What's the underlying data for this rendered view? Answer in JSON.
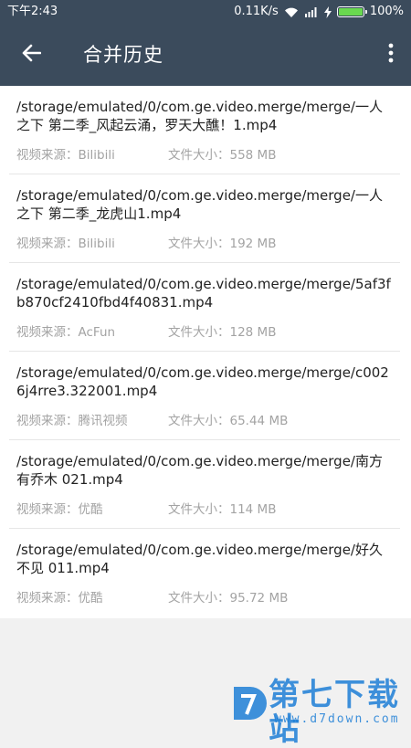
{
  "status_bar": {
    "time": "下午2:43",
    "speed": "0.11K/s",
    "battery": "100%",
    "battery_level": 1.0,
    "battery_color": "#69d84f"
  },
  "toolbar": {
    "title": "合并历史",
    "back_icon": "back-arrow-icon",
    "menu_icon": "more-vertical-icon",
    "background": "#3b4b5c"
  },
  "items": [
    {
      "path": "/storage/emulated/0/com.ge.video.merge/merge/一人之下 第二季_风起云涌，罗天大醮！1.mp4",
      "source": "视频来源：Bilibili",
      "size": "文件大小：558 MB"
    },
    {
      "path": "/storage/emulated/0/com.ge.video.merge/merge/一人之下 第二季_龙虎山1.mp4",
      "source": "视频来源：Bilibili",
      "size": "文件大小：192 MB"
    },
    {
      "path": "/storage/emulated/0/com.ge.video.merge/merge/5af3fb870cf2410fbd4f40831.mp4",
      "source": "视频来源：AcFun",
      "size": "文件大小：128 MB"
    },
    {
      "path": "/storage/emulated/0/com.ge.video.merge/merge/c0026j4rre3.322001.mp4",
      "source": "视频来源：腾讯视频",
      "size": "文件大小：65.44 MB"
    },
    {
      "path": "/storage/emulated/0/com.ge.video.merge/merge/南方有乔木 021.mp4",
      "source": "视频来源：优酷",
      "size": "文件大小：114 MB"
    },
    {
      "path": "/storage/emulated/0/com.ge.video.merge/merge/好久不见 011.mp4",
      "source": "视频来源：优酷",
      "size": "文件大小：95.72 MB"
    }
  ],
  "watermark": {
    "title": "第七下载站",
    "url": "www.d7down.com",
    "color": "#1e7fd6"
  }
}
